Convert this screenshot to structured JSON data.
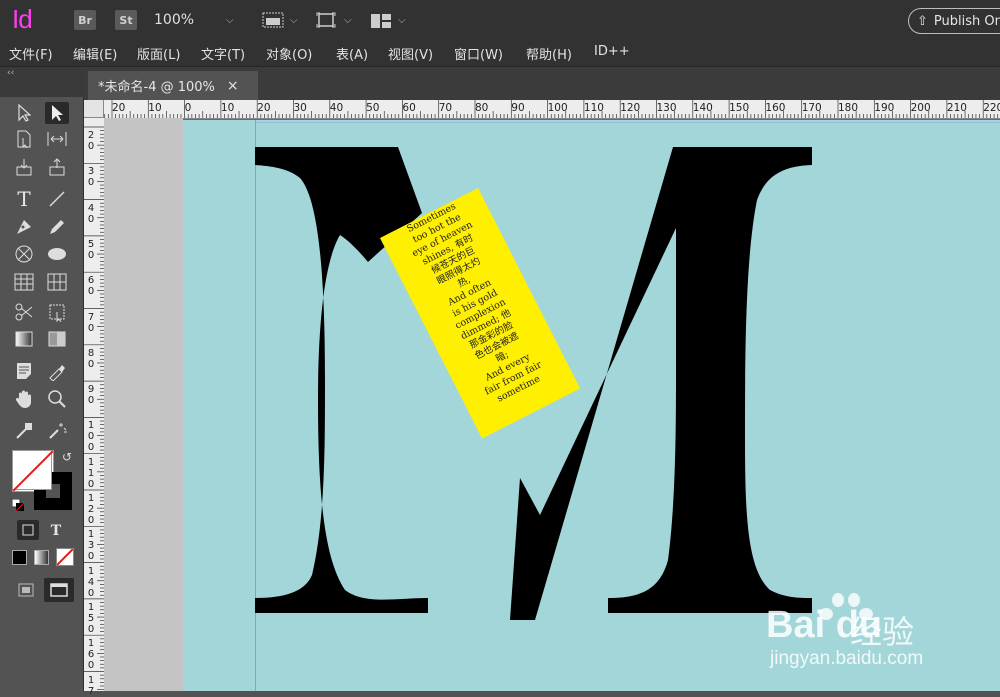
{
  "app": {
    "logo": "Id",
    "badges": [
      "Br",
      "St"
    ],
    "zoom": "100%",
    "publish_label": "Publish Online"
  },
  "menu": [
    "文件(F)",
    "编辑(E)",
    "版面(L)",
    "文字(T)",
    "对象(O)",
    "表(A)",
    "视图(V)",
    "窗口(W)",
    "帮助(H)",
    "ID++"
  ],
  "tab": {
    "title": "*未命名-4 @ 100%",
    "close": "×"
  },
  "ruler": {
    "h": [
      "20",
      "10",
      "0",
      "10",
      "20",
      "30",
      "40",
      "50",
      "60",
      "70",
      "80",
      "90",
      "100",
      "110",
      "120",
      "130",
      "140",
      "150",
      "160",
      "170",
      "180",
      "190",
      "200",
      "210",
      "220"
    ],
    "v": [
      "2\n0",
      "3\n0",
      "4\n0",
      "5\n0",
      "6\n0",
      "7\n0",
      "8\n0",
      "9\n0",
      "1\n0\n0",
      "1\n1\n0",
      "1\n2\n0",
      "1\n3\n0",
      "1\n4\n0",
      "1\n5\n0",
      "1\n6\n0",
      "1\n7"
    ]
  },
  "toolbar": {
    "collapse": "‹‹",
    "type_tool": "T",
    "text_frame_tool": "T"
  },
  "frame_text": "Sometimes\ntoo hot the\neye of heaven\nshines, 有时\n候苍天的巨\n眼照得太灼\n热,\nAnd often\nis his gold\ncomplexion\ndimmed; 他\n那金彩的脸\n色也会被遮\n暗;\nAnd every\nfair from fair\nsometime",
  "watermark": {
    "brand": "Bai du",
    "jingyan": "经验",
    "url": "jingyan.baidu.com"
  },
  "colors": {
    "page_bg": "#a3d6d9",
    "frame_fill": "#ffef00",
    "logo": "#ff3df0",
    "letter": "#000000"
  }
}
